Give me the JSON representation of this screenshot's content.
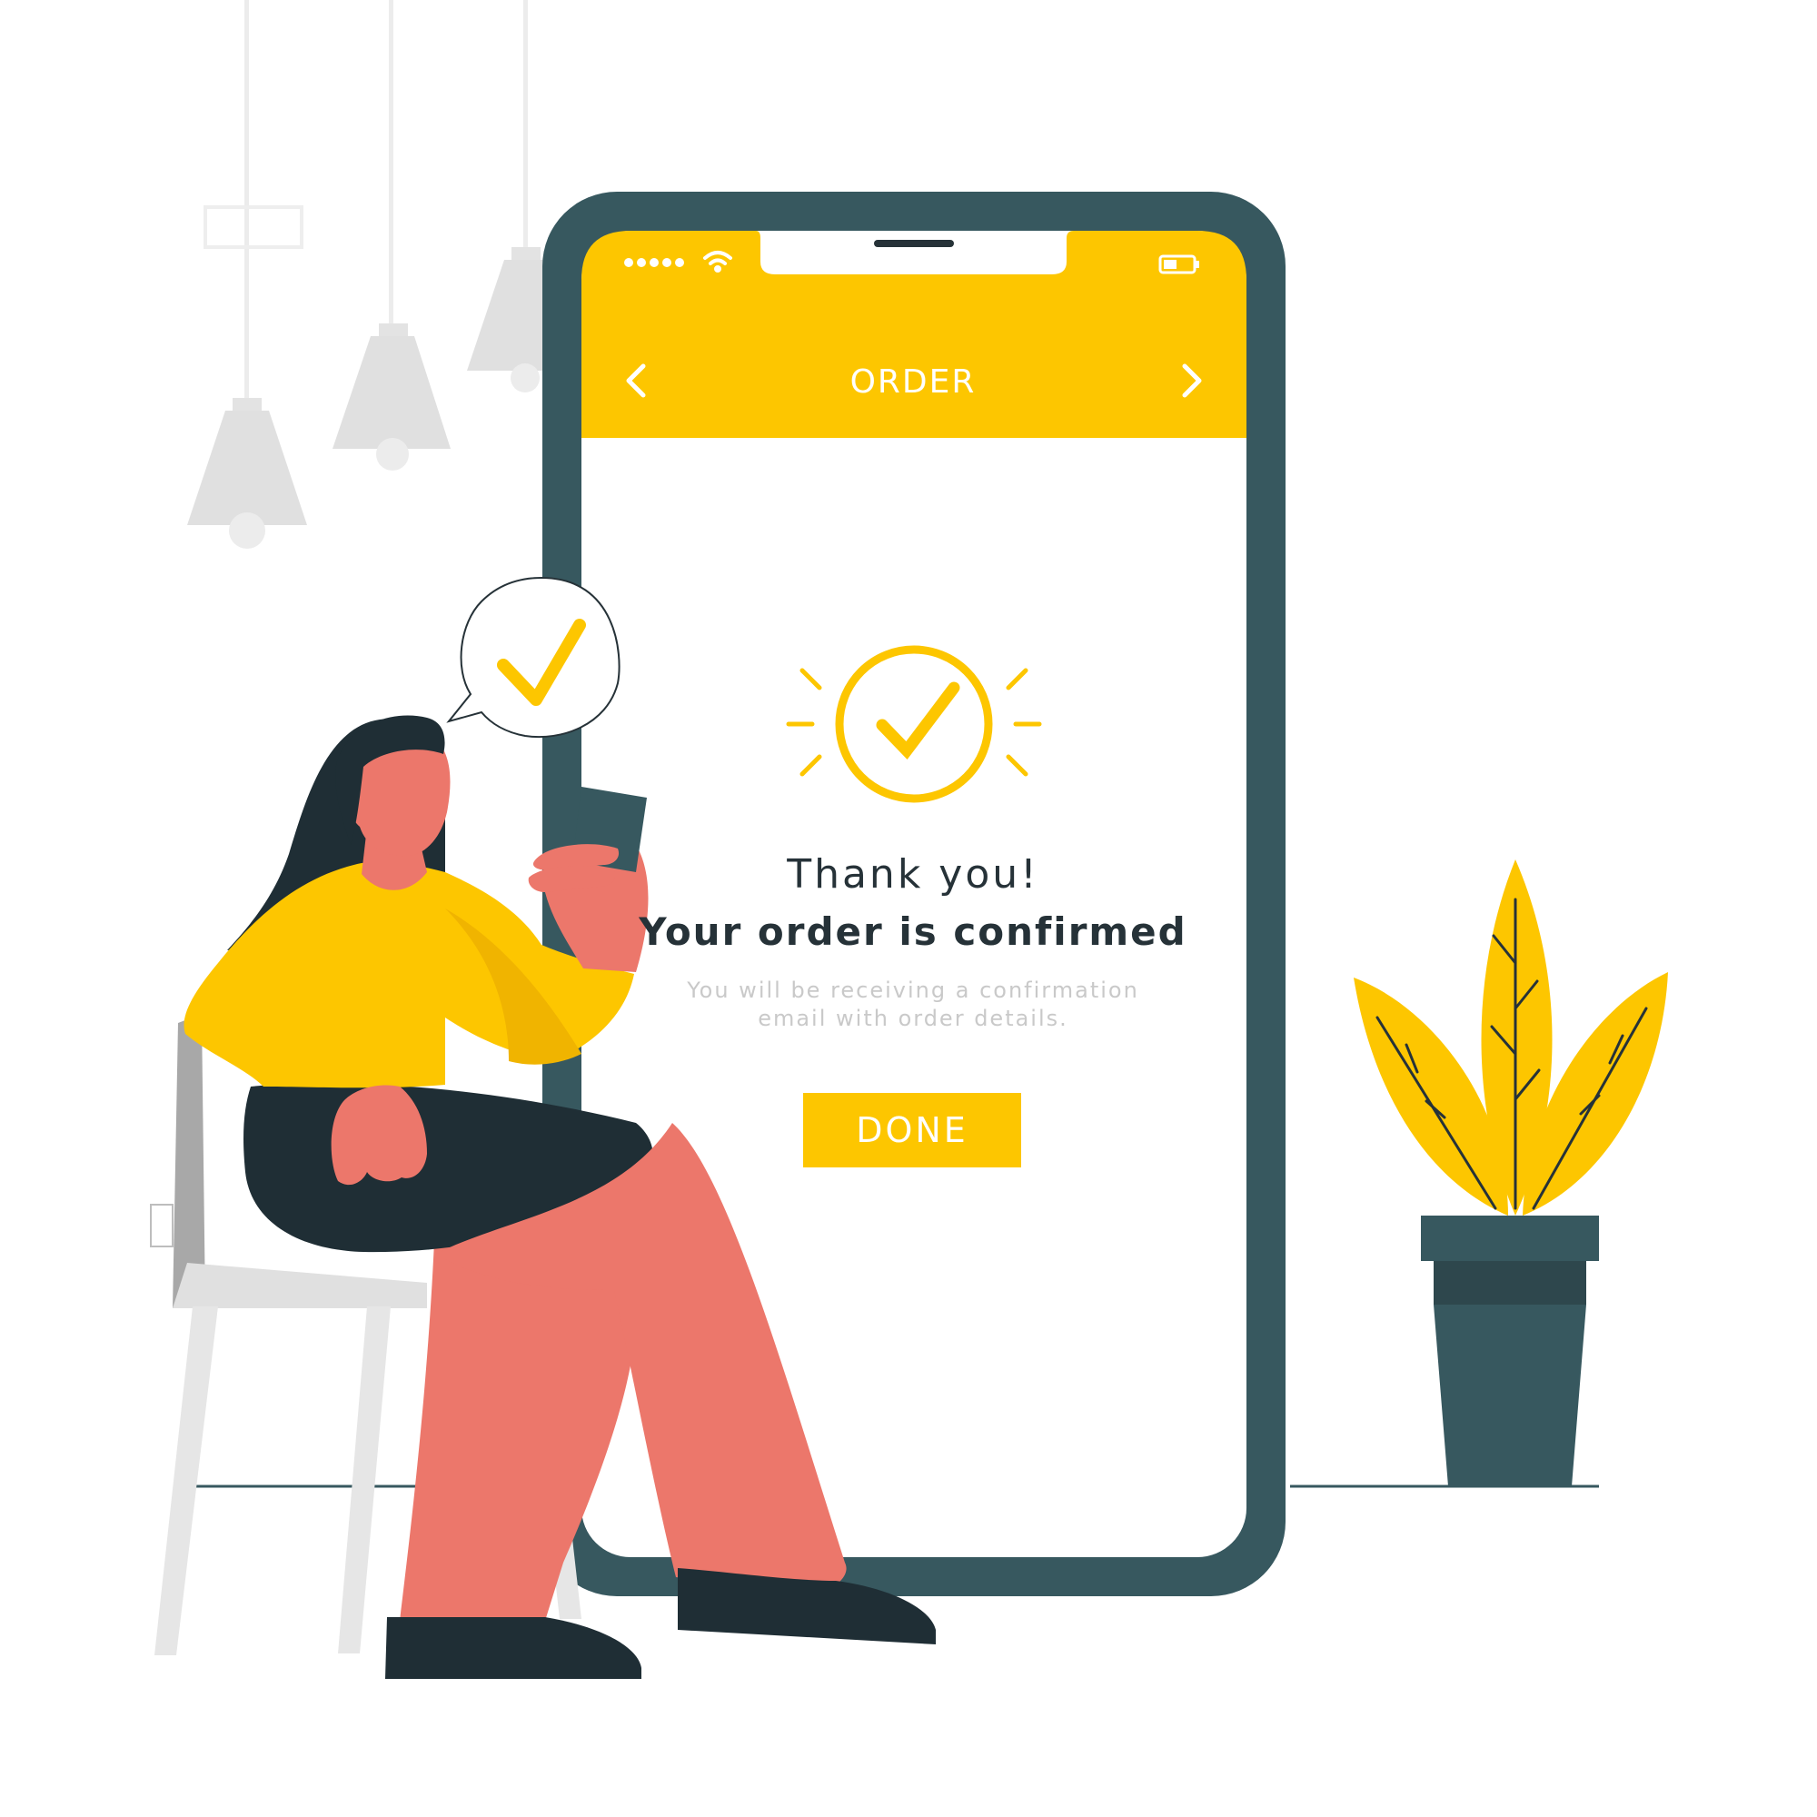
{
  "screen": {
    "title": "ORDER",
    "back_icon": "chevron-left-icon",
    "forward_icon": "chevron-right-icon",
    "status_icons": [
      "signal-dots-icon",
      "wifi-icon",
      "battery-icon"
    ]
  },
  "confirmation": {
    "icon": "check-circle-icon",
    "thank_you": "Thank you!",
    "headline": "Your order is confirmed",
    "message_line_1": "You will be receiving a confirmation",
    "message_line_2": "email with order details.",
    "button_label": "DONE"
  },
  "illustration": {
    "speech_bubble_icon": "check-icon"
  },
  "colors": {
    "accent": "#fdc600",
    "phone_frame": "#37585f",
    "text_dark": "#263238",
    "skin": "#ec776b",
    "hair": "#1f2e35",
    "muted_text": "#c9c9c9"
  }
}
